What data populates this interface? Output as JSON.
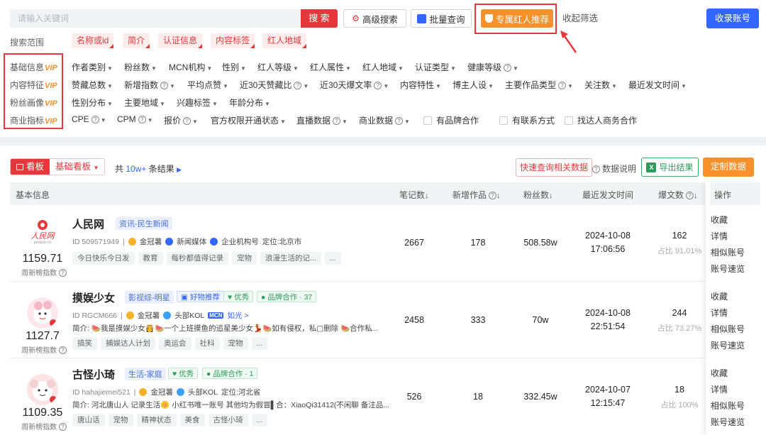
{
  "search": {
    "placeholder": "请输入关键词",
    "button": "搜 索",
    "advanced": "高级搜索",
    "batch": "批量查询",
    "exclusive": "专属红人推荐",
    "collapse": "收起筛选",
    "collect": "收录账号"
  },
  "scope": {
    "label": "搜索范围",
    "tags": [
      "名称或id",
      "简介",
      "认证信息",
      "内容标签",
      "红人地域"
    ]
  },
  "vip": {
    "suffix": "VIP",
    "groups": [
      "基础信息",
      "内容特征",
      "粉丝画像",
      "商业指标"
    ]
  },
  "filters": {
    "row1": [
      "作者类别",
      "粉丝数",
      "MCN机构",
      "性别",
      "红人等级",
      "红人属性",
      "红人地域",
      "认证类型",
      "健康等级"
    ],
    "row2": [
      "赞藏总数",
      "新增指数",
      "平均点赞",
      "近30天赞藏比",
      "近30天爆文率",
      "内容特性",
      "博主人设",
      "主要作品类型",
      "关注数",
      "最近发文时间"
    ],
    "row3": [
      "性别分布",
      "主要地域",
      "兴趣标签",
      "年龄分布"
    ],
    "row4": [
      "CPE",
      "CPM",
      "报价",
      "官方权限开通状态",
      "直播数据",
      "商业数据"
    ],
    "checks": [
      "有品牌合作",
      "有联系方式",
      "找达人商务合作"
    ]
  },
  "toolbar": {
    "board": "看板",
    "board_type": "基础看板",
    "total_prefix": "共",
    "total_value": "10w+",
    "total_suffix": "条结果",
    "quick": "快速查询相关数据",
    "data_note": "数据说明",
    "export": "导出结果",
    "custom": "定制数据"
  },
  "columns": [
    "基本信息",
    "笔记数",
    "新增作品",
    "粉丝数",
    "最近发文时间",
    "爆文数",
    "操作"
  ],
  "ops": [
    "收藏",
    "详情",
    "相似账号",
    "账号速览"
  ],
  "rows": [
    {
      "name": "人民网",
      "category": "资讯-民生新闻",
      "id": "ID 509571949",
      "level": "金冠薯",
      "auth1": "新闻媒体",
      "auth2": "企业机构号",
      "loc": "定位:北京市",
      "index": "1159.71",
      "index_label": "周新榜指数",
      "tags": [
        "今日快乐今日发",
        "教育",
        "每秒都值得记录",
        "宠物",
        "浪漫生活的记...",
        "..."
      ],
      "notes": "2667",
      "new": "178",
      "fans": "508.58w",
      "date": "2024-10-08",
      "time": "17:06:56",
      "hot": "162",
      "hot_pct": "占比 91.01%"
    },
    {
      "name": "摸娱少女",
      "category": "影视综-明星",
      "badge1": "好物推荐",
      "badge2": "优秀",
      "badge3": "品牌合作 · 37",
      "id": "ID RGCM666",
      "level": "金冠薯",
      "auth1": "头部KOL",
      "mcn": "MCN",
      "mcn_name": "如光 >",
      "bio": "简介: 🍉我是摸娱少女👸🍉一个上班摸鱼的追星美少女💃🍉如有侵权，私▢删除 🍉合作私...",
      "index": "1127.7",
      "index_label": "周新榜指数",
      "tags": [
        "搞笑",
        "捕娱达人计划",
        "奥运会",
        "社科",
        "宠物",
        "..."
      ],
      "notes": "2458",
      "new": "333",
      "fans": "70w",
      "date": "2024-10-08",
      "time": "22:51:54",
      "hot": "244",
      "hot_pct": "占比 73.27%"
    },
    {
      "name": "古怪小琦",
      "category": "生活-家庭",
      "badge2": "优秀",
      "badge3": "品牌合作 · 1",
      "id": "ID hahajiemei521",
      "level": "金冠薯",
      "auth1": "头部KOL",
      "loc": "定位:河北省",
      "bio": "简介: 河北唐山人 记录生活🌼 小红书唯一账号 其他均为假冒▌合：XiaoQi31412(不闲聊 备注品...",
      "index": "1109.35",
      "index_label": "周新榜指数",
      "tags": [
        "唐山话",
        "宠物",
        "精神状态",
        "美食",
        "古怪小琦",
        "..."
      ],
      "notes": "526",
      "new": "18",
      "fans": "332.45w",
      "date": "2024-10-07",
      "time": "12:15:47",
      "hot": "18",
      "hot_pct": "占比 100%"
    }
  ]
}
